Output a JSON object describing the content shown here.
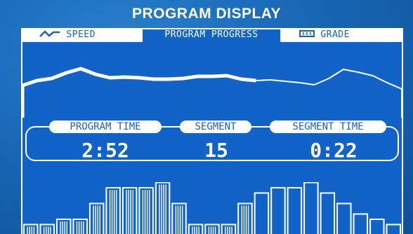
{
  "title": "PROGRAM DISPLAY",
  "tabs": {
    "speed": "SPEED",
    "program_progress": "PROGRAM PROGRESS",
    "grade": "GRADE"
  },
  "readouts": {
    "program_time_label": "PROGRAM TIME",
    "program_time_value": "2:52",
    "segment_label": "SEGMENT",
    "segment_value": "15",
    "segment_time_label": "SEGMENT TIME",
    "segment_time_value": "0:22"
  },
  "speed_profile": [
    122,
    115,
    112,
    104,
    98,
    106,
    111,
    110,
    111,
    113,
    113,
    112,
    109,
    109,
    108,
    113,
    115,
    114,
    116,
    118,
    121,
    112,
    99,
    103,
    108,
    118,
    127
  ],
  "grade_levels": [
    1,
    1,
    2,
    2,
    5,
    8,
    8,
    8,
    9,
    5,
    1,
    1,
    1,
    5,
    7,
    8,
    8,
    9,
    7,
    5,
    3,
    2,
    1
  ],
  "completed_segments": 14,
  "colors": {
    "screen": "#1263c8",
    "outline": "#ffffff",
    "background": "#1865b4"
  },
  "icons": {
    "speed": "speed-wave-icon",
    "grade": "grade-bar-icon"
  }
}
